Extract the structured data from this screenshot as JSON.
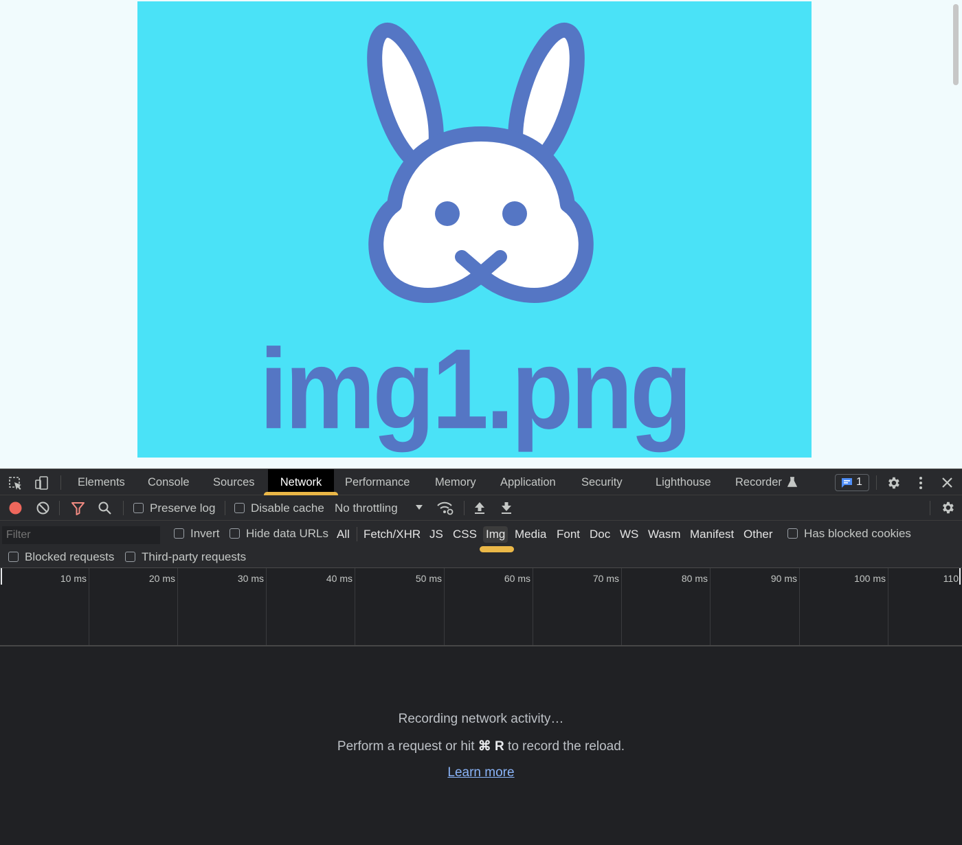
{
  "page": {
    "image_caption": "img1.png",
    "colors": {
      "hero_bg": "#4ae2f7",
      "bunny_stroke": "#5576c4",
      "bunny_fill": "#ffffff"
    }
  },
  "devtools": {
    "tabs": [
      "Elements",
      "Console",
      "Sources",
      "Network",
      "Performance",
      "Memory",
      "Application",
      "Security",
      "Lighthouse",
      "Recorder"
    ],
    "active_tab": "Network",
    "message_count": "1",
    "toolbar": {
      "preserve_log": "Preserve log",
      "disable_cache": "Disable cache",
      "throttling": "No throttling"
    },
    "filter": {
      "placeholder": "Filter",
      "invert": "Invert",
      "hide_data_urls": "Hide data URLs",
      "types": [
        "All",
        "Fetch/XHR",
        "JS",
        "CSS",
        "Img",
        "Media",
        "Font",
        "Doc",
        "WS",
        "Wasm",
        "Manifest",
        "Other"
      ],
      "selected_type": "Img",
      "has_blocked_cookies": "Has blocked cookies",
      "blocked_requests": "Blocked requests",
      "third_party_requests": "Third-party requests"
    },
    "timeline_ticks": [
      "10 ms",
      "20 ms",
      "30 ms",
      "40 ms",
      "50 ms",
      "60 ms",
      "70 ms",
      "80 ms",
      "90 ms",
      "100 ms",
      "110"
    ],
    "empty_state": {
      "title": "Recording network activity…",
      "hint_prefix": "Perform a request or hit ",
      "hint_keys": "⌘ R",
      "hint_suffix": " to record the reload.",
      "learn_more": "Learn more"
    },
    "colors": {
      "record": "#ee675c",
      "filter_icon": "#f28b82",
      "highlight": "#f5c04a",
      "link": "#8ab4f8"
    }
  }
}
